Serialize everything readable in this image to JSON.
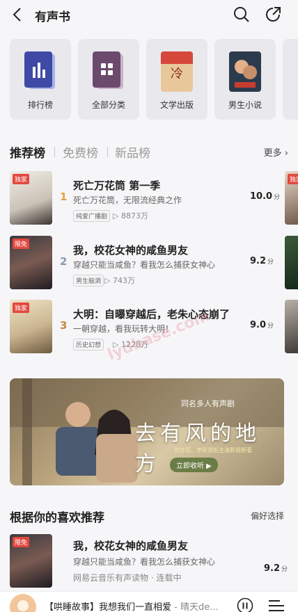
{
  "header": {
    "title": "有声书"
  },
  "categories": [
    {
      "label": "排行榜",
      "icon": "ranking-icon"
    },
    {
      "label": "全部分类",
      "icon": "grid-icon"
    },
    {
      "label": "文学出版",
      "icon": "book-cover"
    },
    {
      "label": "男生小说",
      "icon": "book-cover"
    }
  ],
  "tabs": {
    "recommend": "推荐榜",
    "free": "免费榜",
    "new": "新品榜",
    "more": "更多"
  },
  "rankings": [
    {
      "rank": "1",
      "badge": "独家",
      "name": "死亡万花筒 第一季",
      "desc": "死亡万花筒，无限流经典之作",
      "tag": "纯爱广播剧",
      "plays": "8873万",
      "score": "10.0",
      "unit": "分"
    },
    {
      "rank": "2",
      "badge": "限免",
      "name": "我，校花女神的咸鱼男友",
      "desc": "穿越只能当咸鱼？看我怎么捕获女神心",
      "tag": "男生脑洞",
      "plays": "743万",
      "score": "9.2",
      "unit": "分"
    },
    {
      "rank": "3",
      "badge": "独家",
      "name": "大明：自曝穿越后，老朱心态崩了",
      "desc": "一朝穿越，看我玩转大明！",
      "tag": "历史幻想",
      "plays": "1228万",
      "score": "9.0",
      "unit": "分"
    }
  ],
  "peek_badge": "独家",
  "banner": {
    "subtitle": "同名多人有声剧",
    "title": "去有风的地方",
    "cast": "刘亦菲、李现领衔主演影视原著",
    "cta": "立即收听 ▶"
  },
  "recommend": {
    "title": "根据你的喜欢推荐",
    "pref": "偏好选择",
    "item": {
      "badge": "限免",
      "name": "我，校花女神的咸鱼男友",
      "desc": "穿越只能当咸鱼？看我怎么捕获女神心",
      "source": "网易云音乐有声读物 · 连载中",
      "score": "9.2",
      "unit": "分"
    }
  },
  "player": {
    "title": "【哄睡故事】我想我们一直相爱",
    "artist": " - 晴天de..."
  },
  "colors": {
    "rank1": "#e7a13a",
    "rank2": "#8a9bb0",
    "rank3": "#c98a3e",
    "badge": "#e2483f"
  }
}
